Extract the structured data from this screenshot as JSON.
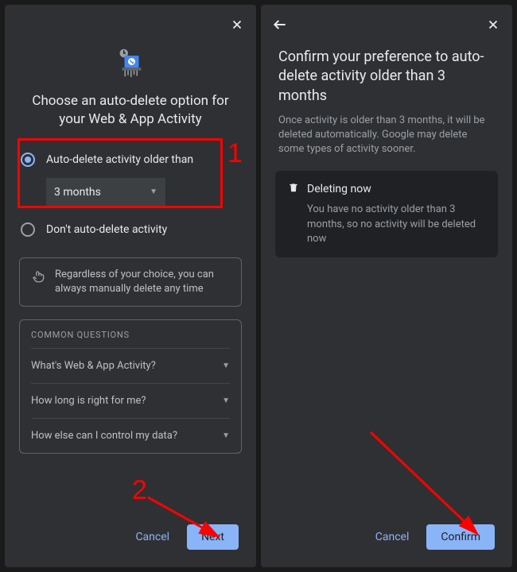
{
  "left": {
    "title": "Choose an auto-delete option for your Web & App Activity",
    "option1_label": "Auto-delete activity older than",
    "select_value": "3 months",
    "option2_label": "Don't auto-delete activity",
    "info_text": "Regardless of your choice, you can always manually delete any time",
    "section_header": "COMMON QUESTIONS",
    "questions": [
      "What's Web & App Activity?",
      "How long is right for me?",
      "How else can I control my data?"
    ],
    "cancel": "Cancel",
    "next": "Next"
  },
  "right": {
    "title": "Confirm your preference to auto-delete activity older than 3 months",
    "subtext": "Once activity is older than 3 months, it will be deleted automatically. Google may delete some types of activity sooner.",
    "deleting_head": "Deleting now",
    "deleting_body": "You have no activity older than 3 months, so no activity will be deleted now",
    "cancel": "Cancel",
    "confirm": "Confirm"
  },
  "annotations": {
    "num1": "1",
    "num2": "2"
  }
}
